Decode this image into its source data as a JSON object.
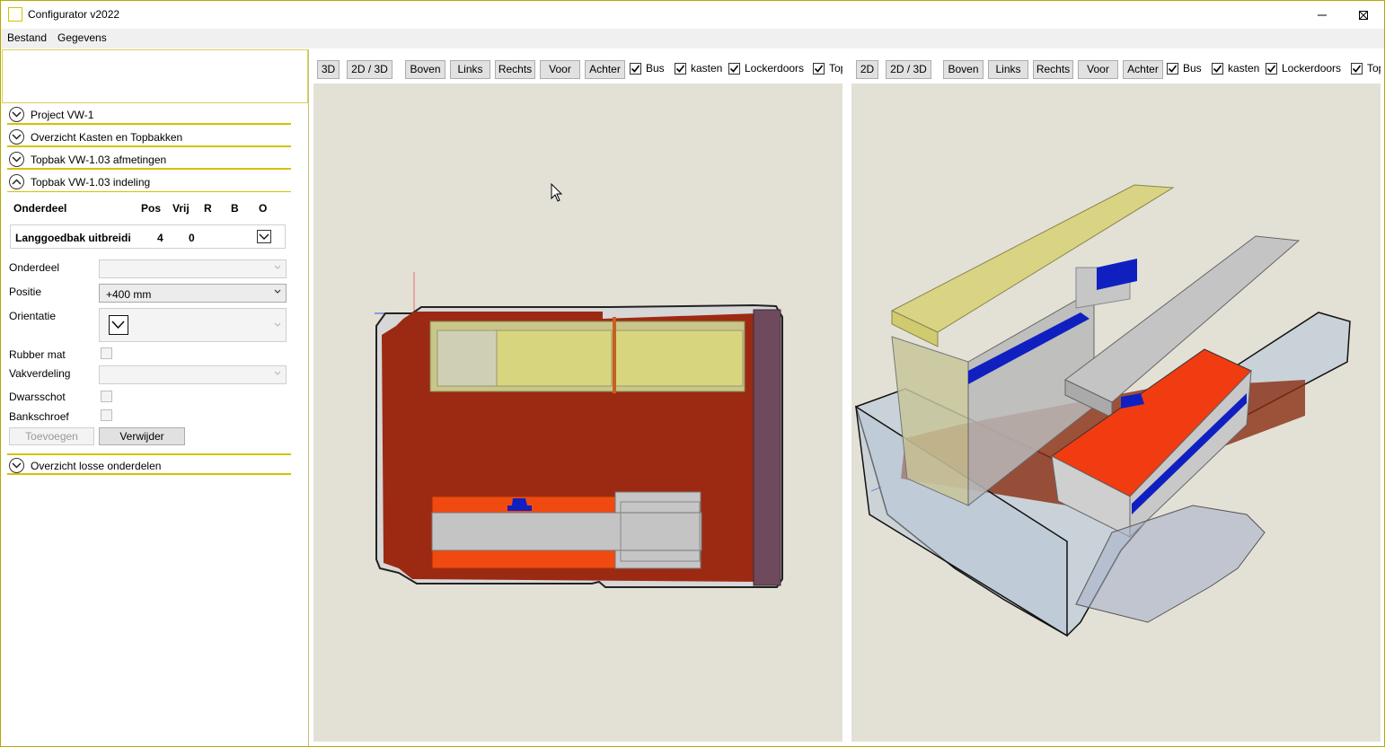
{
  "window": {
    "title": "Configurator v2022"
  },
  "menu": [
    "Bestand",
    "Gegevens"
  ],
  "sections": {
    "project": "Project VW-1",
    "overzicht_kasten": "Overzicht Kasten en Topbakken",
    "afmetingen": "Topbak VW-1.03 afmetingen",
    "indeling": "Topbak VW-1.03 indeling",
    "losse": "Overzicht losse onderdelen"
  },
  "table": {
    "headers": [
      "Onderdeel",
      "Pos",
      "Vrij",
      "R",
      "B",
      "O"
    ],
    "row": {
      "onderdeel": "Langgoedbak uitbreidi",
      "pos": "4",
      "vrij": "0"
    }
  },
  "form": {
    "onderdeel_label": "Onderdeel",
    "onderdeel_value": "",
    "positie_label": "Positie",
    "positie_value": "+400 mm",
    "orientatie_label": "Orientatie",
    "rubber_mat_label": "Rubber mat",
    "vakverdeling_label": "Vakverdeling",
    "dwarsschot_label": "Dwarsschot",
    "bankschroef_label": "Bankschroef",
    "toevoegen": "Toevoegen",
    "verwijder": "Verwijder"
  },
  "viewport_left": {
    "buttons": [
      "3D",
      "2D / 3D",
      "Boven",
      "Links",
      "Rechts",
      "Voor",
      "Achter"
    ],
    "checkboxes": [
      {
        "label": "Bus",
        "checked": true
      },
      {
        "label": "kasten",
        "checked": true
      },
      {
        "label": "Lockerdoors",
        "checked": true
      },
      {
        "label": "Top",
        "checked": true
      }
    ]
  },
  "viewport_right": {
    "buttons": [
      "2D",
      "2D / 3D",
      "Boven",
      "Links",
      "Rechts",
      "Voor",
      "Achter"
    ],
    "checkboxes": [
      {
        "label": "Bus",
        "checked": true
      },
      {
        "label": "kasten",
        "checked": true
      },
      {
        "label": "Lockerdoors",
        "checked": true
      },
      {
        "label": "Top",
        "checked": true
      }
    ]
  },
  "colors": {
    "accent": "#d4c200",
    "floor": "#9c2a12",
    "cabinet_yellow": "#d6d37a",
    "cabinet_orange": "#f04a10",
    "cabinet_grey": "#c6c6c6",
    "part_blue": "#1020c0",
    "wall_purple": "#6e4a5c",
    "viewport_bg": "#e3e1d6"
  }
}
